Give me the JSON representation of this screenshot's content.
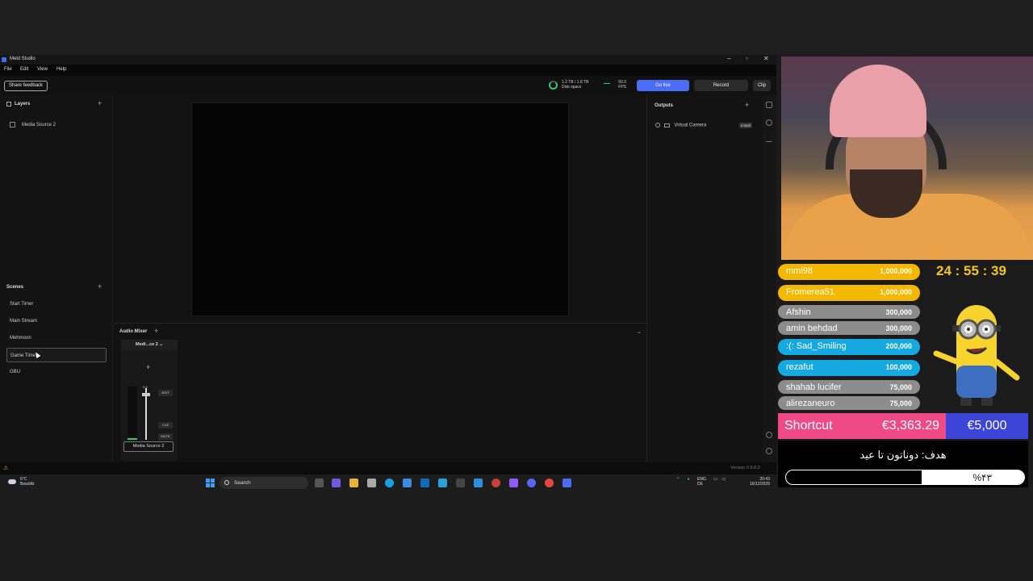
{
  "window": {
    "title": "Meld Studio"
  },
  "menu": [
    "File",
    "Edit",
    "View",
    "Help"
  ],
  "toolbar": {
    "share_feedback": "Share feedback",
    "disk_line1": "1.2 TB / 1.8 TB",
    "disk_line2": "Disk space",
    "fps_value": "60.0",
    "fps_label": "FPS",
    "go_live": "Go live",
    "record": "Record",
    "clip": "Clip"
  },
  "layers": {
    "title": "Layers",
    "items": [
      "Media Source 2"
    ]
  },
  "scenes": {
    "title": "Scenes",
    "items": [
      "Start Timer",
      "Main Stream",
      "Mehmoon",
      "Game Time",
      "GBU"
    ],
    "selected": "Game Time"
  },
  "outputs": {
    "title": "Outputs",
    "virtual_camera": "Virtual Camera",
    "install": "Install"
  },
  "audio_mixer": {
    "title": "Audio Mixer",
    "channel_name": "Medi...ce 2",
    "fader_value": "0.0",
    "edit": "EDIT",
    "cue": "CUE",
    "mute": "MUTE",
    "source_badge": "Media Source 2"
  },
  "status": {
    "version": "Version 0.9.8.3"
  },
  "taskbar": {
    "weather_temp": "6°C",
    "weather_desc": "Bewölkt",
    "search": "Search",
    "lang1": "ENG",
    "lang2": "DE",
    "time": "20:43",
    "date": "16/12/2025"
  },
  "overlay": {
    "countdown": "24 : 55 : 39",
    "donors": [
      {
        "name": "mmi98",
        "amount": "1,000,000",
        "color": "#f5b800"
      },
      {
        "name": "Fromerea51",
        "amount": "1,000,000",
        "color": "#f5b800"
      },
      {
        "name": "Afshin",
        "amount": "300,000",
        "color": "#8c8c8c"
      },
      {
        "name": "amin behdad",
        "amount": "300,000",
        "color": "#8c8c8c"
      },
      {
        "name": ":(: Sad_Smiling",
        "amount": "200,000",
        "color": "#16a8e0"
      },
      {
        "name": "rezafut",
        "amount": "100,000",
        "color": "#16a8e0"
      },
      {
        "name": "shahab lucifer",
        "amount": "75,000",
        "color": "#8c8c8c"
      },
      {
        "name": "alirezaneuro",
        "amount": "75,000",
        "color": "#8c8c8c"
      }
    ],
    "goal": {
      "name": "Shortcut",
      "current": "€3,363.29",
      "target": "€5,000",
      "title_fa": "هدف: دوناتون تا عید",
      "percent_label": "%۴۳",
      "progress": 0.43
    }
  }
}
